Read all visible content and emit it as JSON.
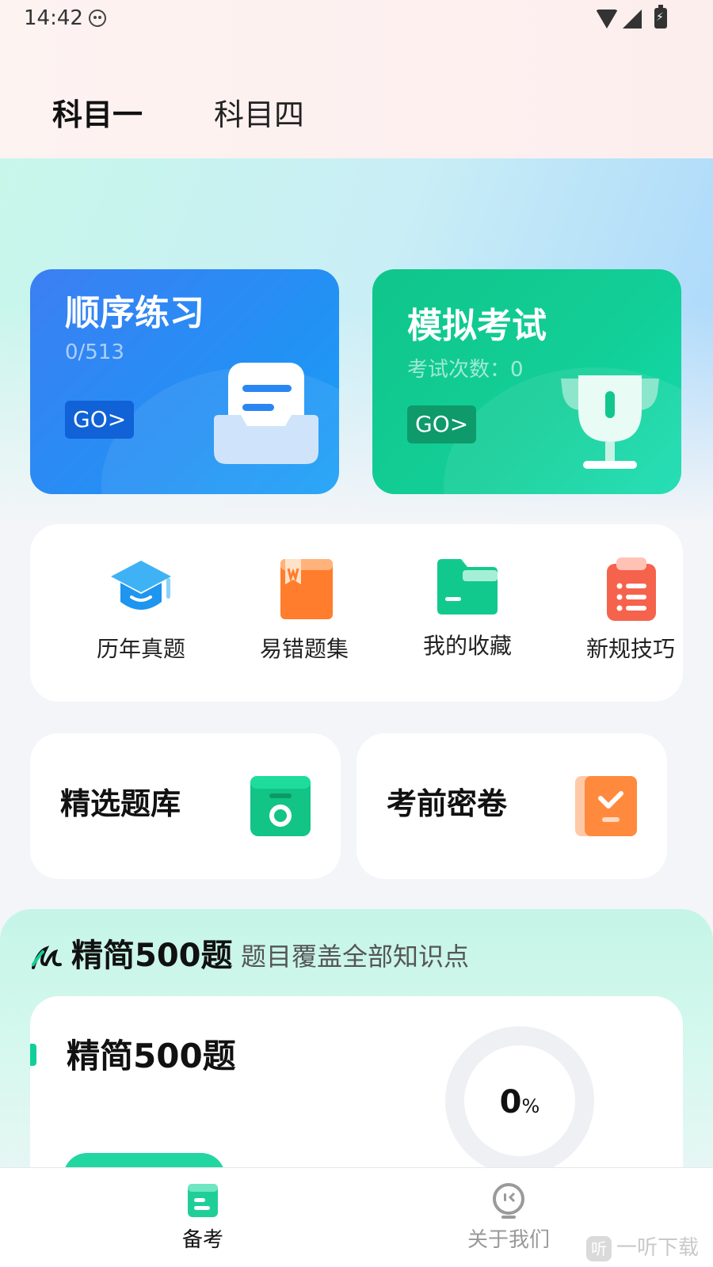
{
  "status_bar": {
    "time": "14:42"
  },
  "subject_tabs": [
    {
      "label": "科目一",
      "active": true
    },
    {
      "label": "科目四",
      "active": false
    }
  ],
  "practice_card": {
    "title": "顺序练习",
    "progress": "0/513",
    "go_label": "GO>"
  },
  "exam_card": {
    "title": "模拟考试",
    "count_text": "考试次数：0",
    "go_label": "GO>"
  },
  "quick_items": [
    {
      "label": "历年真题",
      "icon": "graduation-cap-icon"
    },
    {
      "label": "易错题集",
      "icon": "bookmark-book-icon"
    },
    {
      "label": "我的收藏",
      "icon": "folder-icon"
    },
    {
      "label": "新规技巧",
      "icon": "clipboard-list-icon"
    }
  ],
  "features": [
    {
      "label": "精选题库",
      "icon": "archive-box-icon"
    },
    {
      "label": "考前密卷",
      "icon": "check-paper-icon"
    }
  ],
  "section_500": {
    "title": "精简500题",
    "subtitle": "题目覆盖全部知识点",
    "card_title": "精简500题",
    "progress_value": "0",
    "progress_unit": "%"
  },
  "bottom_nav": [
    {
      "label": "备考",
      "active": true
    },
    {
      "label": "关于我们",
      "active": false
    }
  ],
  "watermark": "一听下载",
  "watermark_logo": "听",
  "colors": {
    "blue": "#2f86f4",
    "green": "#12cf98",
    "orange": "#ff8a3d",
    "red": "#f5634d"
  }
}
